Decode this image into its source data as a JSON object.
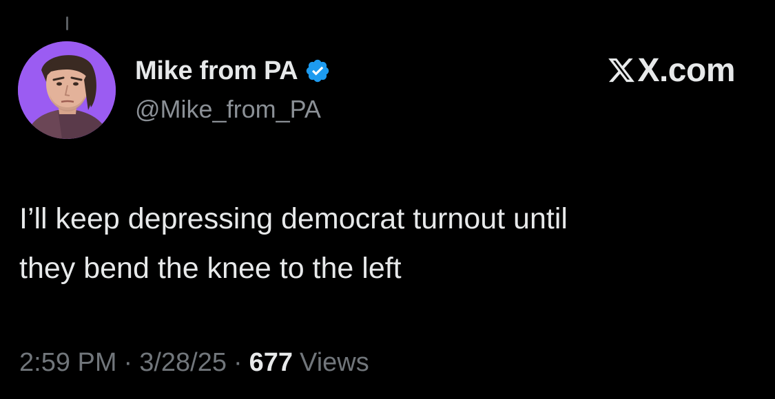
{
  "tweet": {
    "author": {
      "display_name": "Mike from PA",
      "handle": "@Mike_from_PA",
      "verified": true,
      "avatar_icon": "profile-photo",
      "avatar_bg_color": "#9b5cf2"
    },
    "brand": {
      "text": "X.com",
      "icon": "x-logo-icon"
    },
    "body_line_1": "I’ll keep depressing democrat turnout until",
    "body_line_2": "they bend the knee to the left",
    "time": "2:59 PM",
    "date": "3/28/25",
    "separator": "·",
    "views_count": "677",
    "views_label": "Views",
    "colors": {
      "background": "#000000",
      "text_primary": "#e7e9ea",
      "text_secondary": "#71767b",
      "verified_badge": "#1d9bf0"
    }
  }
}
